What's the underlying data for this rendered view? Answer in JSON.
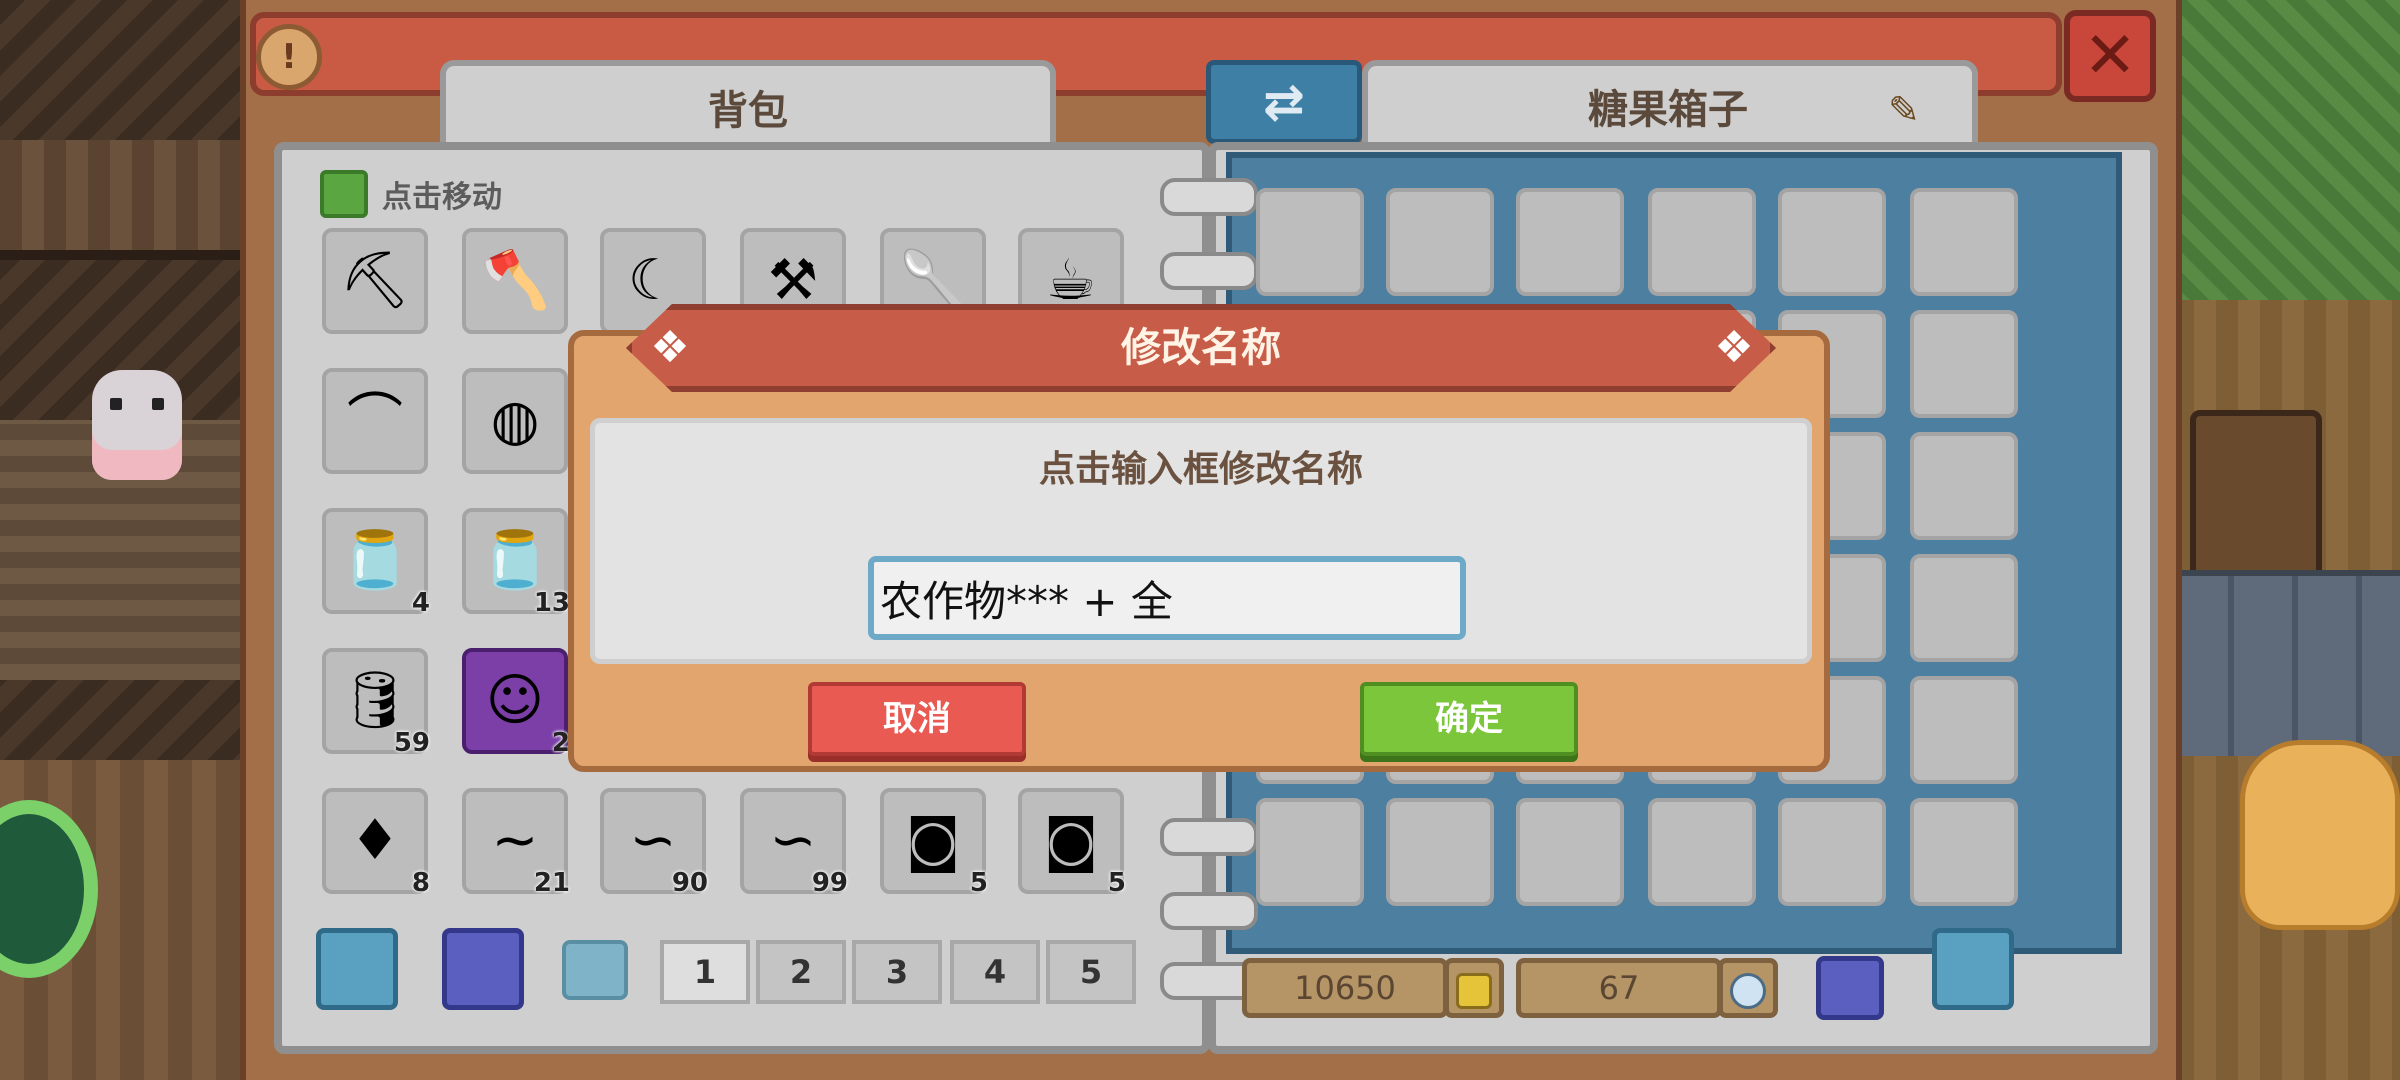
{
  "window": {
    "info_label": "!",
    "close_label": "✕"
  },
  "tabs": {
    "backpack": "背包",
    "swap_label": "⇄",
    "chest_name": "糖果箱子",
    "edit_icon": "pencil-icon"
  },
  "backpack": {
    "move_hint": "点击移动",
    "items": [
      {
        "icon": "pickaxe",
        "glyph": "⛏",
        "count": ""
      },
      {
        "icon": "axe",
        "glyph": "🪓",
        "count": ""
      },
      {
        "icon": "sickle",
        "glyph": "☾",
        "count": ""
      },
      {
        "icon": "hoe",
        "glyph": "⚒",
        "count": ""
      },
      {
        "icon": "shovel",
        "glyph": "🥄",
        "count": ""
      },
      {
        "icon": "watering-can",
        "glyph": "☕",
        "count": ""
      },
      {
        "icon": "fishing-rod",
        "glyph": "⌒",
        "count": ""
      },
      {
        "icon": "ring",
        "glyph": "◍",
        "count": ""
      },
      {
        "icon": "milk-jar",
        "glyph": "🫙",
        "count": "4"
      },
      {
        "icon": "honey-jar",
        "glyph": "🫙",
        "count": "13"
      },
      {
        "icon": "barrel",
        "glyph": "🛢",
        "count": "59"
      },
      {
        "icon": "portrait-card",
        "glyph": "☺",
        "count": "2"
      },
      {
        "icon": "purple-gem",
        "glyph": "♦",
        "count": "8"
      },
      {
        "icon": "red-worm",
        "glyph": "~",
        "count": "21"
      },
      {
        "icon": "earthworm",
        "glyph": "∽",
        "count": "90"
      },
      {
        "icon": "earthworm",
        "glyph": "∽",
        "count": "99"
      },
      {
        "icon": "seed-basket",
        "glyph": "◙",
        "count": "5"
      },
      {
        "icon": "seed-basket-blue",
        "glyph": "◙",
        "count": "5"
      }
    ],
    "pages": [
      "1",
      "2",
      "3",
      "4",
      "5"
    ],
    "active_page": 0
  },
  "currency": {
    "gold": "10650",
    "gems": "67"
  },
  "dialog": {
    "title": "修改名称",
    "hint": "点击输入框修改名称",
    "input_value": "农作物*** + 全",
    "cancel_label": "取消",
    "confirm_label": "确定"
  },
  "colors": {
    "dialog_header": "#c75d49",
    "confirm": "#7cc63c",
    "cancel": "#e85a52",
    "swap": "#3e7fa6"
  }
}
